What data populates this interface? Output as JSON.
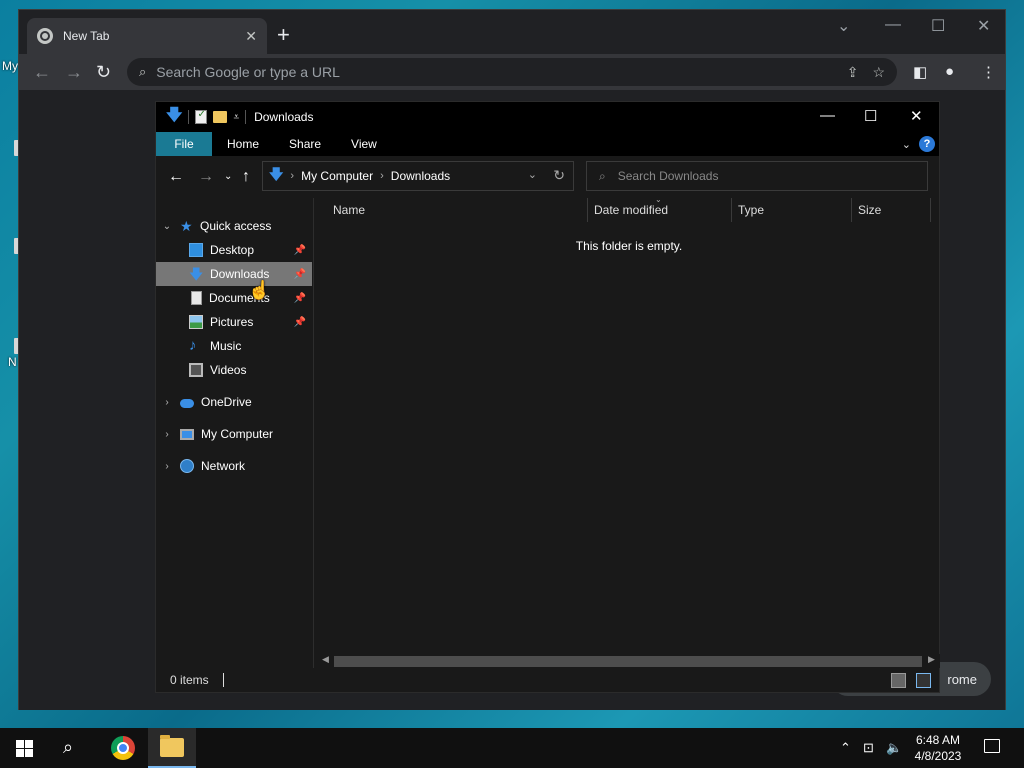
{
  "desktop": {
    "label_my": "My",
    "label_n": "N"
  },
  "chrome": {
    "tab_title": "New Tab",
    "omnibox_placeholder": "Search Google or type a URL",
    "pill_label": "rome"
  },
  "explorer": {
    "title": "Downloads",
    "ribbon_tabs": [
      "File",
      "Home",
      "Share",
      "View"
    ],
    "breadcrumb": [
      "My Computer",
      "Downloads"
    ],
    "search_placeholder": "Search Downloads",
    "nav": {
      "quick_access": "Quick access",
      "desktop": "Desktop",
      "downloads": "Downloads",
      "documents": "Documents",
      "pictures": "Pictures",
      "music": "Music",
      "videos": "Videos",
      "onedrive": "OneDrive",
      "my_computer": "My Computer",
      "network": "Network"
    },
    "columns": [
      "Name",
      "Date modified",
      "Type",
      "Size"
    ],
    "empty_message": "This folder is empty.",
    "status": "0 items"
  },
  "taskbar": {
    "time": "6:48 AM",
    "date": "4/8/2023"
  },
  "colors": {
    "file_tab": "#1a7a94",
    "selected_item": "#777777",
    "accent": "#3a8fe6"
  }
}
